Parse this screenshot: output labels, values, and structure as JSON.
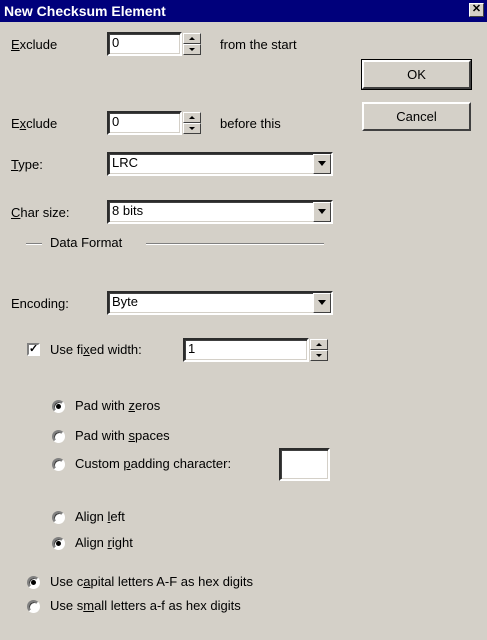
{
  "window": {
    "title": "New Checksum Element",
    "close_glyph": "✕"
  },
  "exclude_start": {
    "label_pre": "E",
    "label_ul": "",
    "label": "Exclude",
    "value": "0",
    "suffix": "from the start"
  },
  "exclude_before": {
    "label": "Exclude",
    "value": "0",
    "suffix": "before this"
  },
  "type": {
    "label": "Type:",
    "value": "LRC"
  },
  "char_size": {
    "label": "Char size:",
    "value": "8 bits"
  },
  "data_format": {
    "label": "Data Format"
  },
  "encoding": {
    "label": "Encoding:",
    "value": "Byte"
  },
  "fixed_width": {
    "label": "Use fixed width:",
    "checked": true,
    "check_glyph": "✓",
    "value": "1"
  },
  "padding": {
    "options": [
      "Pad with zeros",
      "Pad with spaces",
      "Custom padding character:"
    ],
    "selected": 0,
    "custom_char": ""
  },
  "align": {
    "options": [
      "Align left",
      "Align right"
    ],
    "selected": 1
  },
  "hex": {
    "options": [
      "Use capital letters A-F as hex digits",
      "Use small letters a-f as hex digits"
    ],
    "selected": 0
  },
  "buttons": {
    "ok": "OK",
    "cancel": "Cancel"
  }
}
